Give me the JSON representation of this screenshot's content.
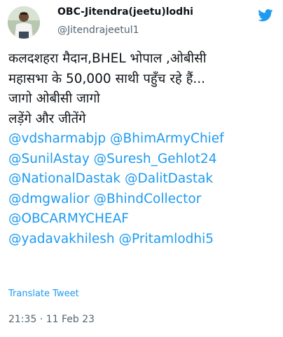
{
  "author": {
    "display_name": "OBC-Jitendra(jeetu)lodhi",
    "handle": "@Jitendrajeetul1"
  },
  "tweet": {
    "text_lines": [
      "कलदशहरा मैदान,BHEL भोपाल ,ओबीसी",
      "महासभा के 50,000 साथी पहुँच रहे हैं...",
      "जागो ओबीसी जागो",
      "लड़ेंगे और जीतेंगे"
    ],
    "mention_lines": [
      "@vdsharmabjp @BhimArmyChief",
      "@SunilAstay @Suresh_Gehlot24",
      "@NationalDastak @DalitDastak",
      "@dmgwalior @BhindCollector",
      "@OBCARMYCHEAF",
      "@yadavakhilesh @Pritamlodhi5"
    ],
    "translate_label": "Translate Tweet",
    "timestamp": "21:35 · 11 Feb 23"
  },
  "icons": {
    "brand": "twitter-bird-icon",
    "avatar": "profile-photo"
  },
  "colors": {
    "link": "#1d9bf0",
    "text": "#0f1419",
    "muted": "#536471",
    "brand": "#1d9bf0"
  }
}
